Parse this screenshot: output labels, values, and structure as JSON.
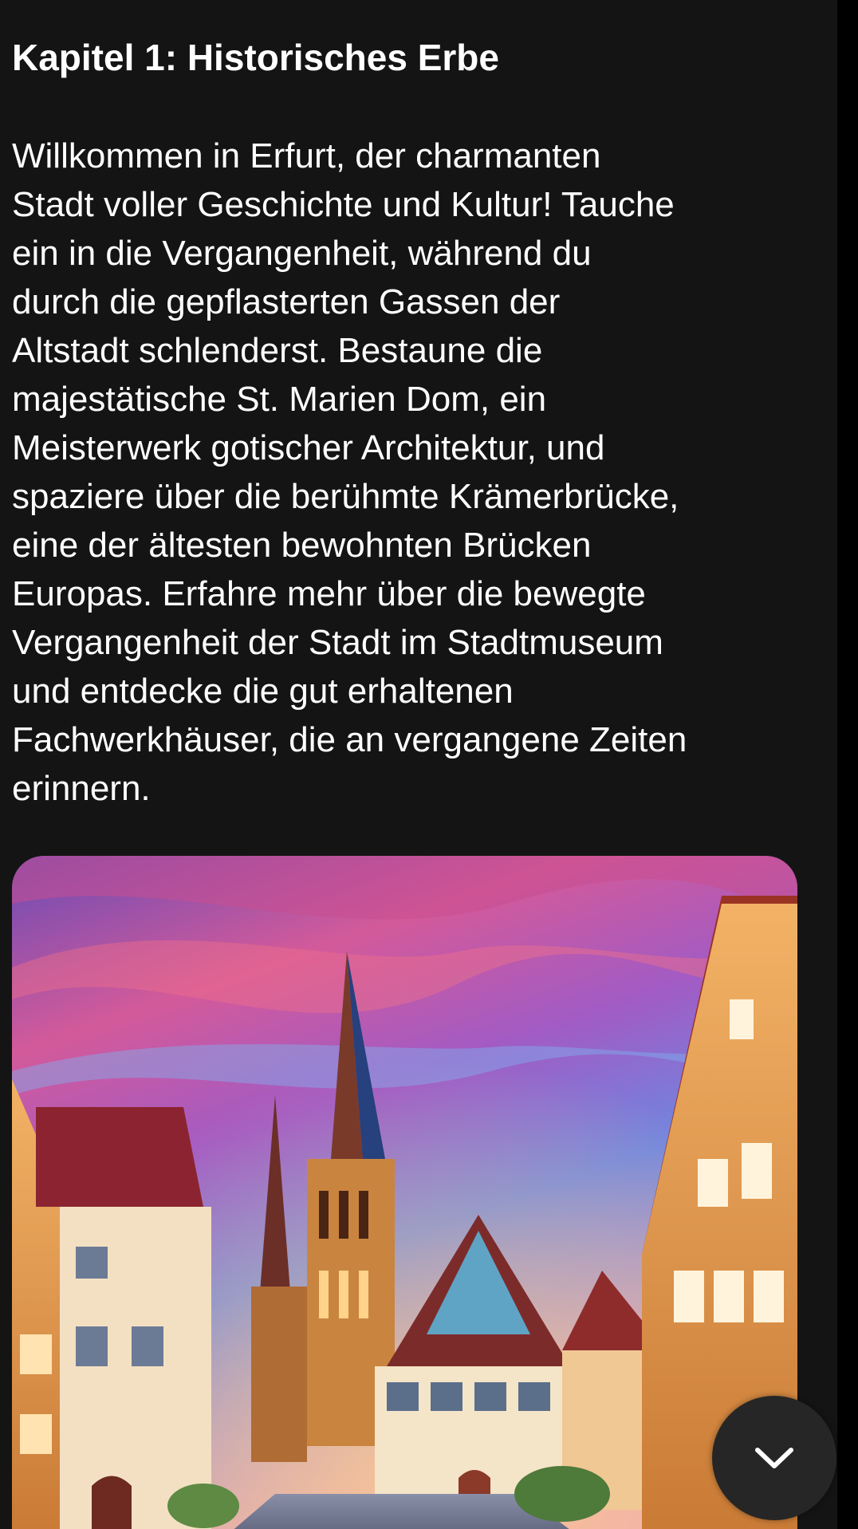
{
  "chapter": {
    "title": "Kapitel 1: Historisches Erbe"
  },
  "body": {
    "lines": [
      "Willkommen in Erfurt, der charmanten",
      "Stadt voller Geschichte und Kultur! Tauche",
      "ein in die Vergangenheit, während du",
      "durch die gepflasterten Gassen der",
      "Altstadt schlenderst. Bestaune die",
      "majestätische St. Marien Dom, ein",
      "Meisterwerk gotischer Architektur, und",
      "spaziere über die berühmte Krämerbrücke,",
      "eine der ältesten bewohnten Brücken",
      "Europas. Erfahre mehr über die bewegte",
      "Vergangenheit der Stadt im Stadtmuseum",
      "und entdecke die gut erhaltenen",
      "Fachwerkhäuser, die an vergangene Zeiten",
      "erinnern."
    ]
  },
  "image": {
    "subject": "illustration of Erfurt old town with cathedral spires and half-timbered houses at sunset"
  },
  "scroll_button": {
    "icon": "chevron-down-icon"
  },
  "colors": {
    "background": "#141414",
    "text": "#ffffff",
    "button": "#262626"
  }
}
